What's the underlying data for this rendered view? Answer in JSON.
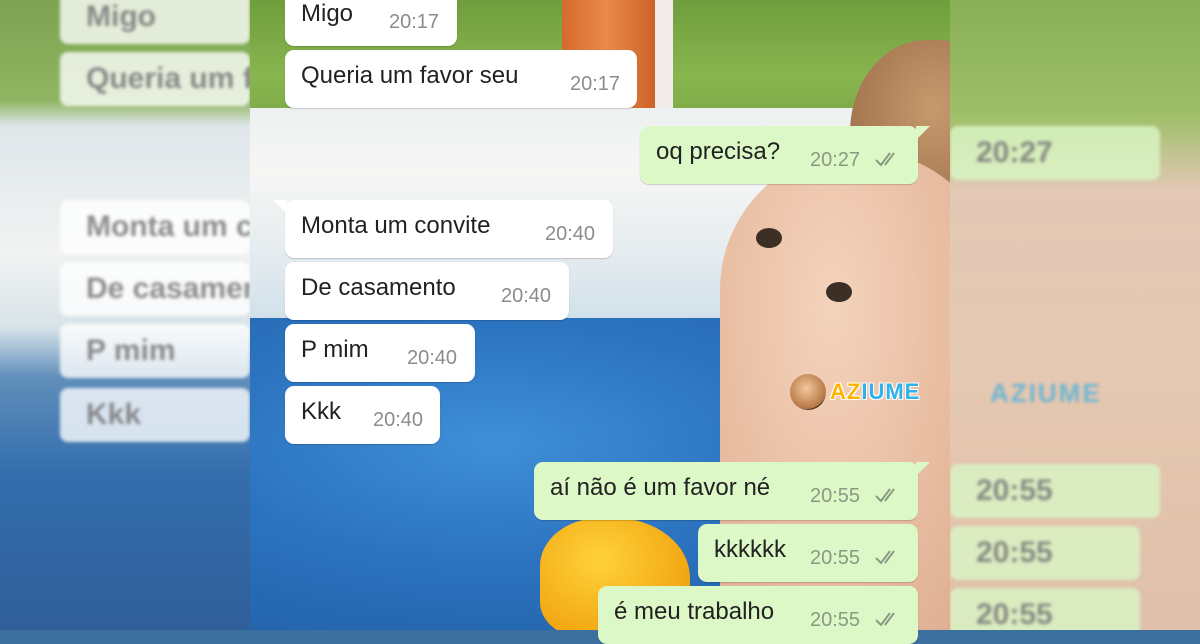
{
  "messages": [
    {
      "side": "in",
      "text": "Migo",
      "time": "20:17",
      "tail": false
    },
    {
      "side": "in",
      "text": "Queria um favor seu",
      "time": "20:17",
      "tail": false
    },
    {
      "side": "out",
      "text": "oq precisa?",
      "time": "20:27",
      "tail": true,
      "status": "read-ticks-icon"
    },
    {
      "side": "in",
      "text": "Monta um convite",
      "time": "20:40",
      "tail": true
    },
    {
      "side": "in",
      "text": "De casamento",
      "time": "20:40",
      "tail": false
    },
    {
      "side": "in",
      "text": "P mim",
      "time": "20:40",
      "tail": false
    },
    {
      "side": "in",
      "text": "Kkk",
      "time": "20:40",
      "tail": false
    },
    {
      "side": "out",
      "text": "aí não é um favor né",
      "time": "20:55",
      "tail": true,
      "status": "read-ticks-icon"
    },
    {
      "side": "out",
      "text": "kkkkkk",
      "time": "20:55",
      "tail": false,
      "status": "read-ticks-icon"
    },
    {
      "side": "out",
      "text": "é meu trabalho",
      "time": "20:55",
      "tail": false,
      "status": "read-ticks-icon"
    }
  ],
  "watermark": {
    "prefix": "AZ",
    "suffix": "IUME",
    "accent": "#ffb400",
    "color": "#2fb1ea",
    "icon": "mascot-icon"
  },
  "colors": {
    "incoming": "#ffffff",
    "outgoing": "#dcf8c6",
    "tick": "#8a9a82"
  }
}
